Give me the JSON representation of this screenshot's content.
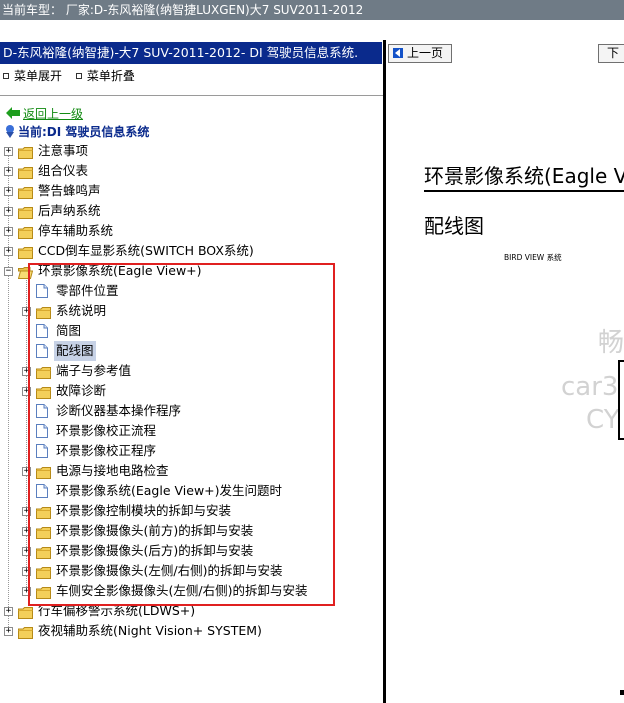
{
  "topbar": {
    "text": "当前车型：  厂家:D-东风裕隆(纳智捷LUXGEN)大7 SUV2011-2012"
  },
  "left_pane": {
    "title": "D-东风裕隆(纳智捷)-大7 SUV-2011-2012- DI 驾驶员信息系统.",
    "expand_all": "菜单展开",
    "collapse_all": "菜单折叠",
    "back_link": "返回上一级",
    "current": "当前:DI 驾驶员信息系统"
  },
  "tree": {
    "items": [
      {
        "label": "注意事项",
        "level": 0,
        "type": "folder",
        "toggle": "+"
      },
      {
        "label": "组合仪表",
        "level": 0,
        "type": "folder",
        "toggle": "+"
      },
      {
        "label": "警告蜂鸣声",
        "level": 0,
        "type": "folder",
        "toggle": "+"
      },
      {
        "label": "后声纳系统",
        "level": 0,
        "type": "folder",
        "toggle": "+"
      },
      {
        "label": "停车辅助系统",
        "level": 0,
        "type": "folder",
        "toggle": "+"
      },
      {
        "label": "CCD倒车显影系统(SWITCH BOX系统)",
        "level": 0,
        "type": "folder",
        "toggle": "+"
      },
      {
        "label": "环景影像系统(Eagle View+)",
        "level": 0,
        "type": "folder-open",
        "toggle": "-"
      },
      {
        "label": "零部件位置",
        "level": 1,
        "type": "doc"
      },
      {
        "label": "系统说明",
        "level": 1,
        "type": "folder",
        "toggle": "+"
      },
      {
        "label": "简图",
        "level": 1,
        "type": "doc"
      },
      {
        "label": "配线图",
        "level": 1,
        "type": "doc",
        "selected": true
      },
      {
        "label": "端子与参考值",
        "level": 1,
        "type": "folder",
        "toggle": "+"
      },
      {
        "label": "故障诊断",
        "level": 1,
        "type": "folder",
        "toggle": "+"
      },
      {
        "label": "诊断仪器基本操作程序",
        "level": 1,
        "type": "doc"
      },
      {
        "label": "环景影像校正流程",
        "level": 1,
        "type": "doc"
      },
      {
        "label": "环景影像校正程序",
        "level": 1,
        "type": "doc"
      },
      {
        "label": "电源与接地电路检查",
        "level": 1,
        "type": "folder",
        "toggle": "+"
      },
      {
        "label": "环景影像系统(Eagle View+)发生问题时",
        "level": 1,
        "type": "doc"
      },
      {
        "label": "环景影像控制模块的拆卸与安装",
        "level": 1,
        "type": "folder",
        "toggle": "+"
      },
      {
        "label": "环景影像摄像头(前方)的拆卸与安装",
        "level": 1,
        "type": "folder",
        "toggle": "+"
      },
      {
        "label": "环景影像摄像头(后方)的拆卸与安装",
        "level": 1,
        "type": "folder",
        "toggle": "+"
      },
      {
        "label": "环景影像摄像头(左侧/右侧)的拆卸与安装",
        "level": 1,
        "type": "folder",
        "toggle": "+"
      },
      {
        "label": "车侧安全影像摄像头(左侧/右侧)的拆卸与安装",
        "level": 1,
        "type": "folder",
        "toggle": "+"
      },
      {
        "label": "行车偏移警示系统(LDWS+)",
        "level": 0,
        "type": "folder",
        "toggle": "+"
      },
      {
        "label": "夜视辅助系统(Night Vision+ SYSTEM)",
        "level": 0,
        "type": "folder",
        "toggle": "+"
      }
    ]
  },
  "right_pane": {
    "prev_button": "上一页",
    "next_button": "下",
    "doc_title": "环景影像系统(Eagle V",
    "doc_subtitle": "配线图",
    "doc_small": "BIRD VIEW 系统",
    "watermark_1": "畅",
    "watermark_2": "car3",
    "watermark_3": "CY"
  },
  "colors": {
    "topbar_bg": "#6f7b86",
    "title_bg": "#0a2a8c",
    "back_link": "#118a11",
    "highlight_box": "#e02020",
    "folder_yellow": "#f3cf5a",
    "selected_bg": "#c7d2e6"
  }
}
